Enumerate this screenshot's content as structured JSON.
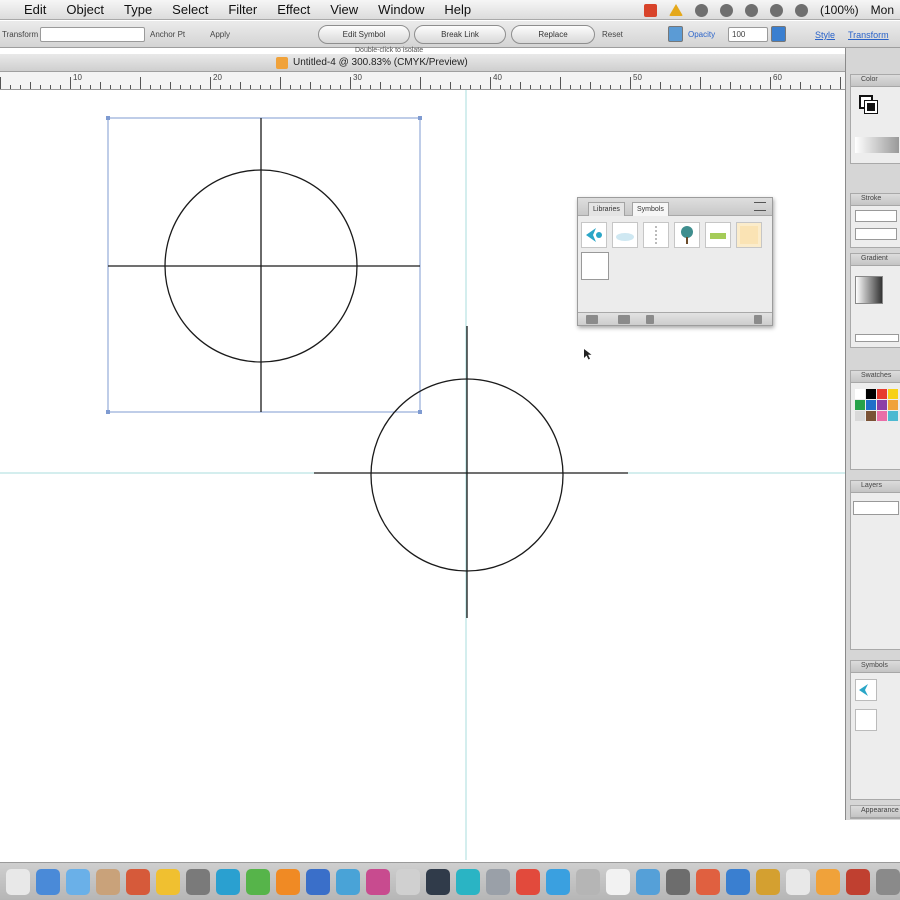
{
  "menubar": {
    "menus": [
      "Edit",
      "Object",
      "Type",
      "Select",
      "Filter",
      "Effect",
      "View",
      "Window",
      "Help"
    ],
    "clock": "(100%)",
    "user": "Mon"
  },
  "controlbar": {
    "left_label": "Transform",
    "label_2": "Anchor Pt",
    "label_3": "Apply",
    "btn_1": "Edit Symbol",
    "btn_2": "Break Link",
    "btn_3": "Replace",
    "label_reset": "Reset",
    "opacity_label": "Opacity",
    "opacity_value": "100",
    "link_1": "Style",
    "link_2": "Transform"
  },
  "document": {
    "title": "Untitled-4 @ 300.83% (CMYK/Preview)",
    "above_label": "Double-click to isolate"
  },
  "ruler": {
    "numbers": [
      "",
      "10",
      "",
      "20",
      "",
      "30",
      "",
      "40",
      "",
      "50",
      "",
      "60"
    ]
  },
  "symbols_panel": {
    "tab_1": "Libraries",
    "tab_2": "Symbols",
    "symbols": [
      "bird-icon",
      "cloud-icon",
      "ribbon-icon",
      "tree-icon",
      "grass-icon",
      "blank-icon"
    ]
  },
  "dock": {
    "color_label": "Color",
    "stroke_label": "Stroke",
    "gradient_label": "Gradient",
    "swatches_label": "Swatches",
    "layers_label": "Layers",
    "symbols_label": "Symbols",
    "appearance_label": "Appearance",
    "swatch_colors": [
      "#ffffff",
      "#000000",
      "#e63b2e",
      "#f7d117",
      "#27a24a",
      "#1f6fc9",
      "#8c3fa7",
      "#f0a23a",
      "#d9d9d9",
      "#7a5235",
      "#e96ea8",
      "#4db9d1"
    ]
  },
  "colors": {
    "guide": "#a8dede",
    "bbox": "#7f9bd1",
    "stroke": "#1a1a1a",
    "accent": "#2aa6c7"
  }
}
